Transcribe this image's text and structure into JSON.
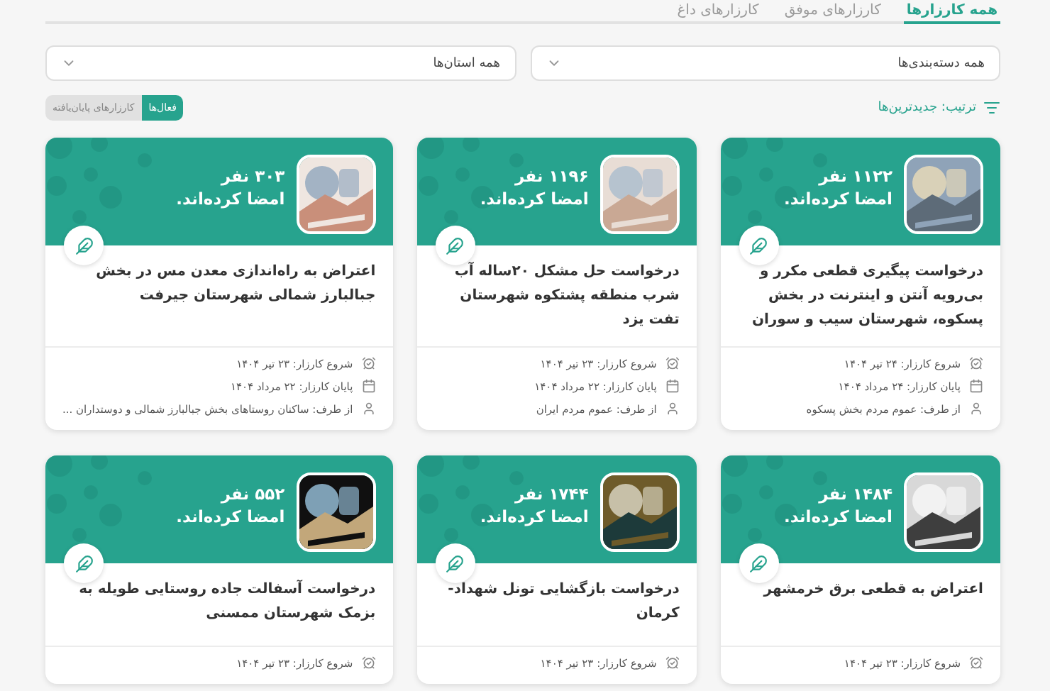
{
  "tabs": [
    {
      "label": "همه کارزارها",
      "selected": true
    },
    {
      "label": "کارزارهای موفق",
      "selected": false
    },
    {
      "label": "کارزارهای داغ",
      "selected": false
    }
  ],
  "dropdowns": [
    {
      "value": "همه دسته‌بندی‌ها"
    },
    {
      "value": "همه استان‌ها"
    }
  ],
  "sort": {
    "label": "ترتیب: جدیدترین‌ها"
  },
  "filters": [
    {
      "label": "فعال‌ها",
      "selected": true
    },
    {
      "label": "کارزارهای پایان‌یافته",
      "selected": false
    }
  ],
  "cards": [
    {
      "count": "۱۱۲۲ نفر",
      "signed": "امضا کرده‌اند.",
      "title": "درخواست پیگیری قطعی مکرر و بی‌رویه آنتن و اینترنت در بخش پسکوه، شهرستان سیب و سوران",
      "meta": [
        {
          "kind": "start",
          "text": "شروع کارزار: ۲۴ تیر ۱۴۰۴"
        },
        {
          "kind": "end",
          "text": "پایان کارزار: ۲۴ مرداد ۱۴۰۴"
        },
        {
          "kind": "author",
          "text": "از طرف: عموم مردم بخش پسکوه"
        }
      ]
    },
    {
      "count": "۱۱۹۶ نفر",
      "signed": "امضا کرده‌اند.",
      "title": "درخواست حل مشکل ۲۰ساله آب شرب منطقه پشتکوه شهرستان تفت یزد",
      "meta": [
        {
          "kind": "start",
          "text": "شروع کارزار: ۲۳ تیر ۱۴۰۴"
        },
        {
          "kind": "end",
          "text": "پایان کارزار: ۲۲ مرداد ۱۴۰۴"
        },
        {
          "kind": "author",
          "text": "از طرف: عموم مردم ایران"
        }
      ]
    },
    {
      "count": "۳۰۳ نفر",
      "signed": "امضا کرده‌اند.",
      "title": "اعتراض به راه‌اندازی معدن مس در بخش جبالبارز شمالی شهرستان جیرفت",
      "meta": [
        {
          "kind": "start",
          "text": "شروع کارزار: ۲۳ تیر ۱۴۰۴"
        },
        {
          "kind": "end",
          "text": "پایان کارزار: ۲۲ مرداد ۱۴۰۴"
        },
        {
          "kind": "author",
          "text": "از طرف: ساکنان روستاهای بخش جبالبارز شمالی و دوستداران ..."
        }
      ]
    },
    {
      "count": "۱۴۸۴ نفر",
      "signed": "امضا کرده‌اند.",
      "title": "اعتراض به قطعی برق خرمشهر",
      "meta": [
        {
          "kind": "start",
          "text": "شروع کارزار: ۲۳ تیر ۱۴۰۴"
        }
      ]
    },
    {
      "count": "۱۷۴۴ نفر",
      "signed": "امضا کرده‌اند.",
      "title": "درخواست بازگشایی تونل شهداد-کرمان",
      "meta": [
        {
          "kind": "start",
          "text": "شروع کارزار: ۲۳ تیر ۱۴۰۴"
        }
      ]
    },
    {
      "count": "۵۵۲ نفر",
      "signed": "امضا کرده‌اند.",
      "title": "درخواست آسفالت جاده روستایی طویله به بزمک شهرستان ممسنی",
      "meta": [
        {
          "kind": "start",
          "text": "شروع کارزار: ۲۳ تیر ۱۴۰۴"
        }
      ]
    }
  ]
}
